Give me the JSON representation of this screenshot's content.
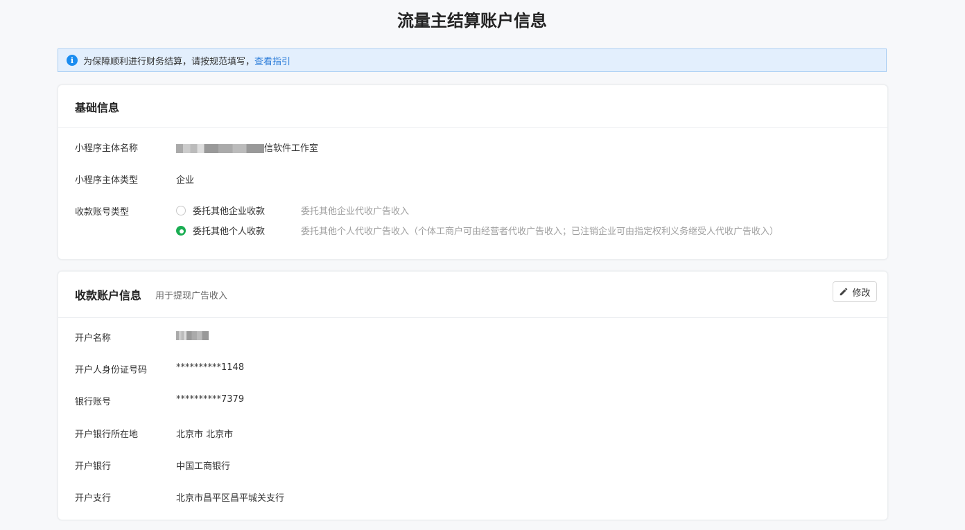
{
  "page_title": "流量主结算账户信息",
  "notice": {
    "text": "为保障顺利进行财务结算，请按规范填写，",
    "link": "查看指引"
  },
  "basic": {
    "title": "基础信息",
    "rows": [
      {
        "label": "小程序主体名称",
        "value": "信软件工作室"
      },
      {
        "label": "小程序主体类型",
        "value": "企业"
      },
      {
        "label": "收款账号类型"
      }
    ],
    "radios": [
      {
        "label": "委托其他企业收款",
        "desc": "委托其他企业代收广告收入",
        "checked": false
      },
      {
        "label": "委托其他个人收款",
        "desc": "委托其他个人代收广告收入（个体工商户可由经营者代收广告收入；已注销企业可由指定权利义务继受人代收广告收入）",
        "checked": true
      }
    ]
  },
  "account": {
    "title": "收款账户信息",
    "subtitle": "用于提现广告收入",
    "edit_label": "修改",
    "rows": [
      {
        "label": "开户名称",
        "value": ""
      },
      {
        "label": "开户人身份证号码",
        "value": "**********1148"
      },
      {
        "label": "银行账号",
        "value": "**********7379"
      },
      {
        "label": "开户银行所在地",
        "value": "北京市 北京市"
      },
      {
        "label": "开户银行",
        "value": "中国工商银行"
      },
      {
        "label": "开户支行",
        "value": "北京市昌平区昌平城关支行"
      }
    ]
  },
  "colors": {
    "accent_green": "#1aad52",
    "link_blue": "#2b7cd9",
    "notice_bg": "#e3effd"
  }
}
